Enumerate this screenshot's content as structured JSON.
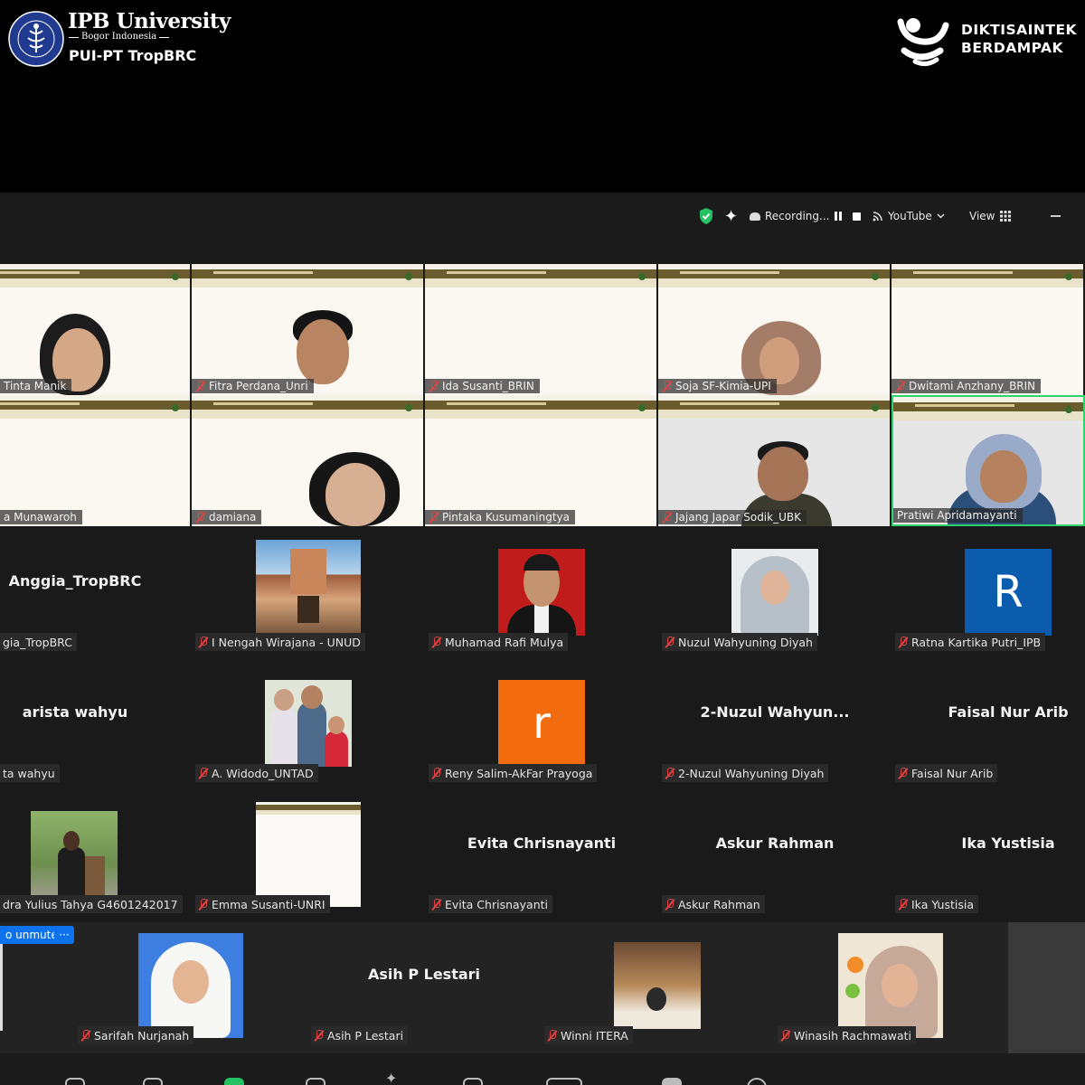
{
  "branding": {
    "university": "IPB University",
    "city": "Bogor Indonesia",
    "unit": "PUI-PT TropBRC",
    "right_logo_line1": "DIKTISAINTEK",
    "right_logo_line2": "BERDAMPAK",
    "logo_ring_text": "INSTITUT PERTANIAN BOGOR"
  },
  "topbar": {
    "recording_label": "Recording...",
    "youtube_label": "YouTube",
    "view_label": "View",
    "icons": [
      "shield-check-icon",
      "sparkle-icon",
      "cloud-record-icon",
      "pause-icon",
      "stop-icon",
      "broadcast-icon",
      "chevron-down-icon",
      "grid-icon",
      "minimize-icon"
    ]
  },
  "video_tiles": [
    {
      "name": "Tinta Manik"
    },
    {
      "name": "Fitra Perdana_Unri"
    },
    {
      "name": "Ida Susanti_BRIN"
    },
    {
      "name": "Soja SF-Kimia-UPI"
    },
    {
      "name": "Dwitami Anzhany_BRIN"
    },
    {
      "name": "a Munawaroh"
    },
    {
      "name": "damiana"
    },
    {
      "name": "Pintaka Kusumaningtya"
    },
    {
      "name": "Jajang Japar Sodik_UBK"
    },
    {
      "name": "Pratiwi Apridamayanti",
      "active": true
    }
  ],
  "participants": [
    {
      "display": "Anggia_TropBRC",
      "label": "gia_TropBRC",
      "muted": false
    },
    {
      "label": "I Nengah Wirajana - UNUD",
      "muted": true,
      "avatar": "building-photo"
    },
    {
      "label": "Muhamad Rafi Mulya",
      "muted": true,
      "avatar": "portrait-red"
    },
    {
      "label": "Nuzul Wahyuning Diyah",
      "muted": true,
      "avatar": "portrait-hijab"
    },
    {
      "label": "Ratna Kartika Putri_IPB",
      "muted": true,
      "letter": "R",
      "color": "#0b5cad"
    },
    {
      "display": "arista wahyu",
      "label": "ta wahyu",
      "muted": false
    },
    {
      "label": "A. Widodo_UNTAD",
      "muted": true,
      "avatar": "family-photo"
    },
    {
      "label": "Reny Salim-AkFar Prayoga",
      "muted": true,
      "letter": "r",
      "color": "#f26b0f"
    },
    {
      "display": "2-Nuzul  Wahyun...",
      "label": "2-Nuzul Wahyuning Diyah",
      "muted": true
    },
    {
      "display": "Faisal Nur Arib",
      "label": "Faisal Nur Arib",
      "muted": true
    },
    {
      "label": "dra Yulius Tahya G4601242017",
      "muted": false,
      "avatar": "garden-photo"
    },
    {
      "label": "Emma Susanti-UNRI",
      "muted": true,
      "avatar": "slide-thumb"
    },
    {
      "display": "Evita Chrisnayanti",
      "label": "Evita Chrisnayanti",
      "muted": true
    },
    {
      "display": "Askur Rahman",
      "label": "Askur Rahman",
      "muted": true
    },
    {
      "display": "Ika Yustisia",
      "label": "Ika Yustisia",
      "muted": true
    }
  ],
  "bottom_participants": [
    {
      "label": "Sarifah Nurjanah",
      "muted": true,
      "avatar": "portrait-blue-hijab"
    },
    {
      "display": "Asih P Lestari",
      "label": "Asih P Lestari",
      "muted": true
    },
    {
      "label": "Winni ITERA",
      "muted": true,
      "avatar": "room-photo"
    },
    {
      "label": "Winasih Rachmawati",
      "muted": true,
      "avatar": "portrait-hijab-wall"
    }
  ],
  "overlay": {
    "unmute_label": "o unmute",
    "more_label": "···"
  },
  "colors": {
    "active_speaker": "#2fd26b",
    "muted_icon": "#e24343",
    "accent": "#0e72ed"
  }
}
